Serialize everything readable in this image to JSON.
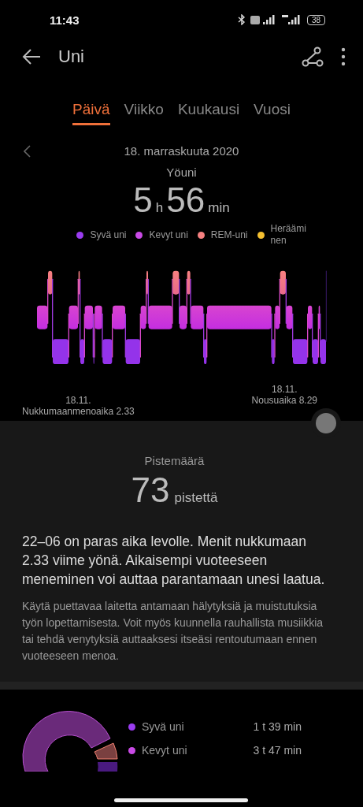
{
  "status_bar": {
    "time": "11:43",
    "battery": "38"
  },
  "header": {
    "title": "Uni"
  },
  "tabs": [
    {
      "label": "Päivä",
      "selected": true
    },
    {
      "label": "Viikko",
      "selected": false
    },
    {
      "label": "Kuukausi",
      "selected": false
    },
    {
      "label": "Vuosi",
      "selected": false
    }
  ],
  "date": "18. marraskuuta 2020",
  "summary": {
    "label": "Yöuni",
    "hours": "5",
    "hours_unit": "h",
    "minutes": "56",
    "minutes_unit": "min"
  },
  "legend": [
    {
      "label": "Syvä uni",
      "color": "#9a3cf0"
    },
    {
      "label": "Kevyt uni",
      "color": "#c94ae6"
    },
    {
      "label": "REM-uni",
      "color": "#f58080"
    },
    {
      "label": "Herääminen",
      "color": "#f5c030"
    }
  ],
  "bedtime": {
    "date": "18.11.",
    "label": "Nukkumaanmenoaika 2.33"
  },
  "wake": {
    "date": "18.11.",
    "label": "Nousuaika 8.29"
  },
  "score": {
    "label": "Pistemäärä",
    "value": "73",
    "unit": "pistettä"
  },
  "advice": "22–06 on paras aika levolle. Menit nukkumaan 2.33 viime yönä. Aikaisempi vuoteeseen meneminen voi auttaa parantamaan unesi laatua.",
  "tip": "Käytä puettavaa laitetta antamaan hälytyksiä ja muistutuksia työn lopettamisesta. Voit myös kuunnella rauhallista musiikkia tai tehdä venytyksiä auttaaksesi itseäsi rentoutumaan ennen vuoteeseen menoa.",
  "breakdown": [
    {
      "label": "Syvä uni",
      "value": "1 t 39 min",
      "color": "#9a3cf0"
    },
    {
      "label": "Kevyt uni",
      "value": "3 t 47 min",
      "color": "#c94ae6"
    }
  ]
}
